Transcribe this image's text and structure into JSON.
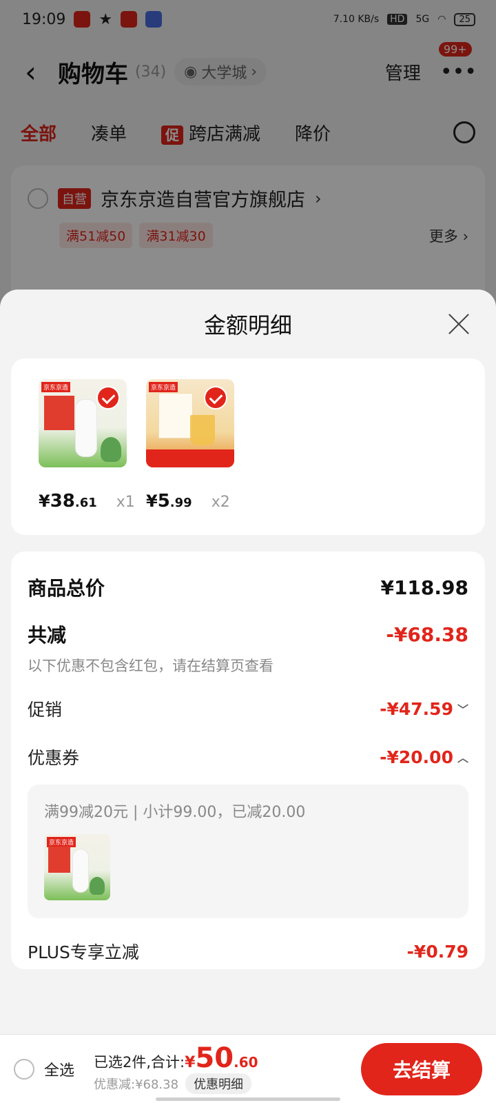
{
  "status_bar": {
    "time": "19:09",
    "net_speed": "7.10 KB/s",
    "hd": "HD",
    "signal": "5G",
    "battery": "25"
  },
  "header": {
    "back_icon": "chevron-left-icon",
    "title": "购物车",
    "count": "(34)",
    "location": "大学城",
    "manage": "管理",
    "badge": "99+"
  },
  "tabs": {
    "all": "全部",
    "combine": "凑单",
    "promo_tag": "促",
    "cross_store": "跨店满减",
    "price_drop": "降价"
  },
  "store": {
    "tag": "自营",
    "name": "京东京造自营官方旗舰店",
    "coupons": [
      "满51减50",
      "满31减30"
    ],
    "more": "更多"
  },
  "sheet": {
    "title": "金额明细",
    "products": [
      {
        "price_symbol": "¥",
        "price_int": "38",
        "price_dec": ".61",
        "qty": "x1"
      },
      {
        "price_symbol": "¥",
        "price_int": "5",
        "price_dec": ".99",
        "qty": "x2"
      }
    ],
    "total_label": "商品总价",
    "total_value": "¥118.98",
    "discount_label": "共减",
    "discount_value": "-¥68.38",
    "discount_note": "以下优惠不包含红包，请在结算页查看",
    "promo_label": "促销",
    "promo_value": "-¥47.59",
    "coupon_label": "优惠券",
    "coupon_value": "-¥20.00",
    "coupon_detail": "满99减20元 | 小计99.00，已减20.00",
    "plus_label": "PLUS专享立减",
    "plus_value": "-¥0.79"
  },
  "bottom_bar": {
    "select_all": "全选",
    "selected_prefix": "已选2件,合计:",
    "total_symbol": "¥",
    "total_int": "50",
    "total_dec": ".60",
    "saved": "优惠减:¥68.38",
    "detail_pill": "优惠明细",
    "checkout": "去结算"
  },
  "colors": {
    "brand_red": "#e1251b",
    "sheet_bg": "#f3f3f3"
  }
}
